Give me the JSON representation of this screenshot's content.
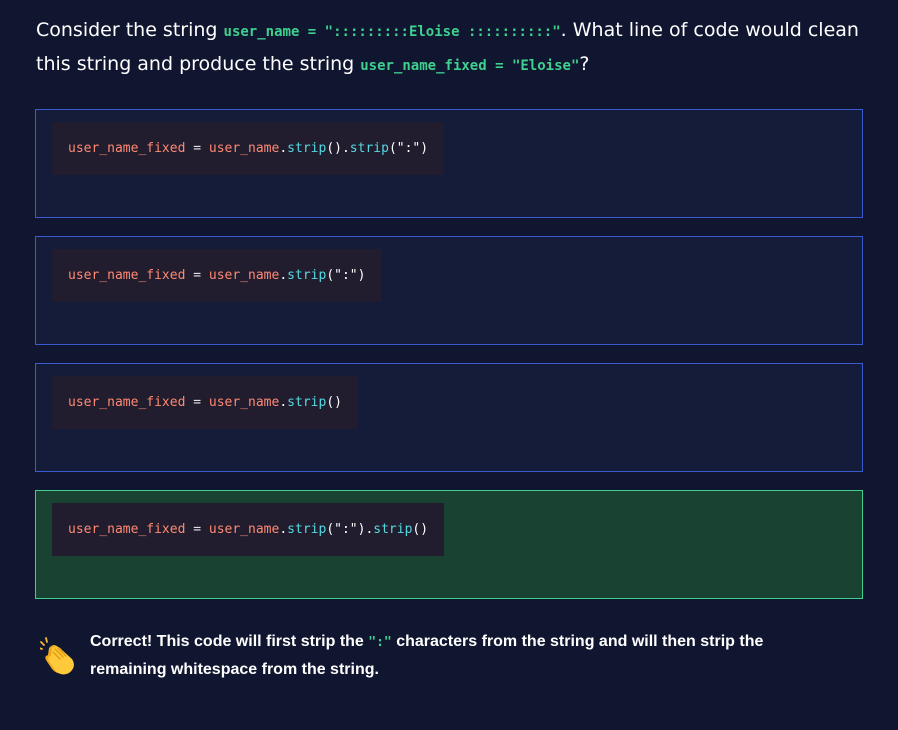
{
  "question": {
    "prefix": "Consider the string ",
    "code1": "user_name = \":::::::::Eloise ::::::::::\"",
    "middle": ". What line of code would clean this string and produce the string ",
    "code2": "user_name_fixed = \"Eloise\"",
    "suffix": "?"
  },
  "options": [
    {
      "tokens": {
        "lhs": "user_name_fixed",
        "eq": " = ",
        "obj": "user_name",
        "dot": ".",
        "m1": "strip",
        "p1": "()",
        "dot2": ".",
        "m2": "strip",
        "p2o": "(",
        "arg": "\":\"",
        "p2c": ")"
      }
    },
    {
      "tokens": {
        "lhs": "user_name_fixed",
        "eq": " = ",
        "obj": "user_name",
        "dot": ".",
        "m1": "strip",
        "p1o": "(",
        "arg": "\":\"",
        "p1c": ")"
      }
    },
    {
      "tokens": {
        "lhs": "user_name_fixed",
        "eq": " = ",
        "obj": "user_name",
        "dot": ".",
        "m1": "strip",
        "p1": "()"
      }
    },
    {
      "tokens": {
        "lhs": "user_name_fixed",
        "eq": " = ",
        "obj": "user_name",
        "dot": ".",
        "m1": "strip",
        "p1o": "(",
        "arg": "\":\"",
        "p1c": ")",
        "dot2": ".",
        "m2": "strip",
        "p2": "()"
      },
      "state": "correct"
    }
  ],
  "feedback": {
    "icon": "clapping-hands-icon",
    "text_before": "Correct! This code will first strip the ",
    "code": "\":\"",
    "text_after": " characters from the string and will then strip the remaining whitespace from the string."
  },
  "colors": {
    "background": "#10162f",
    "option_border": "#3a5bd0",
    "correct_border": "#3fcf8e",
    "correct_background": "#1a4232",
    "inline_code": "#3fd08f"
  }
}
